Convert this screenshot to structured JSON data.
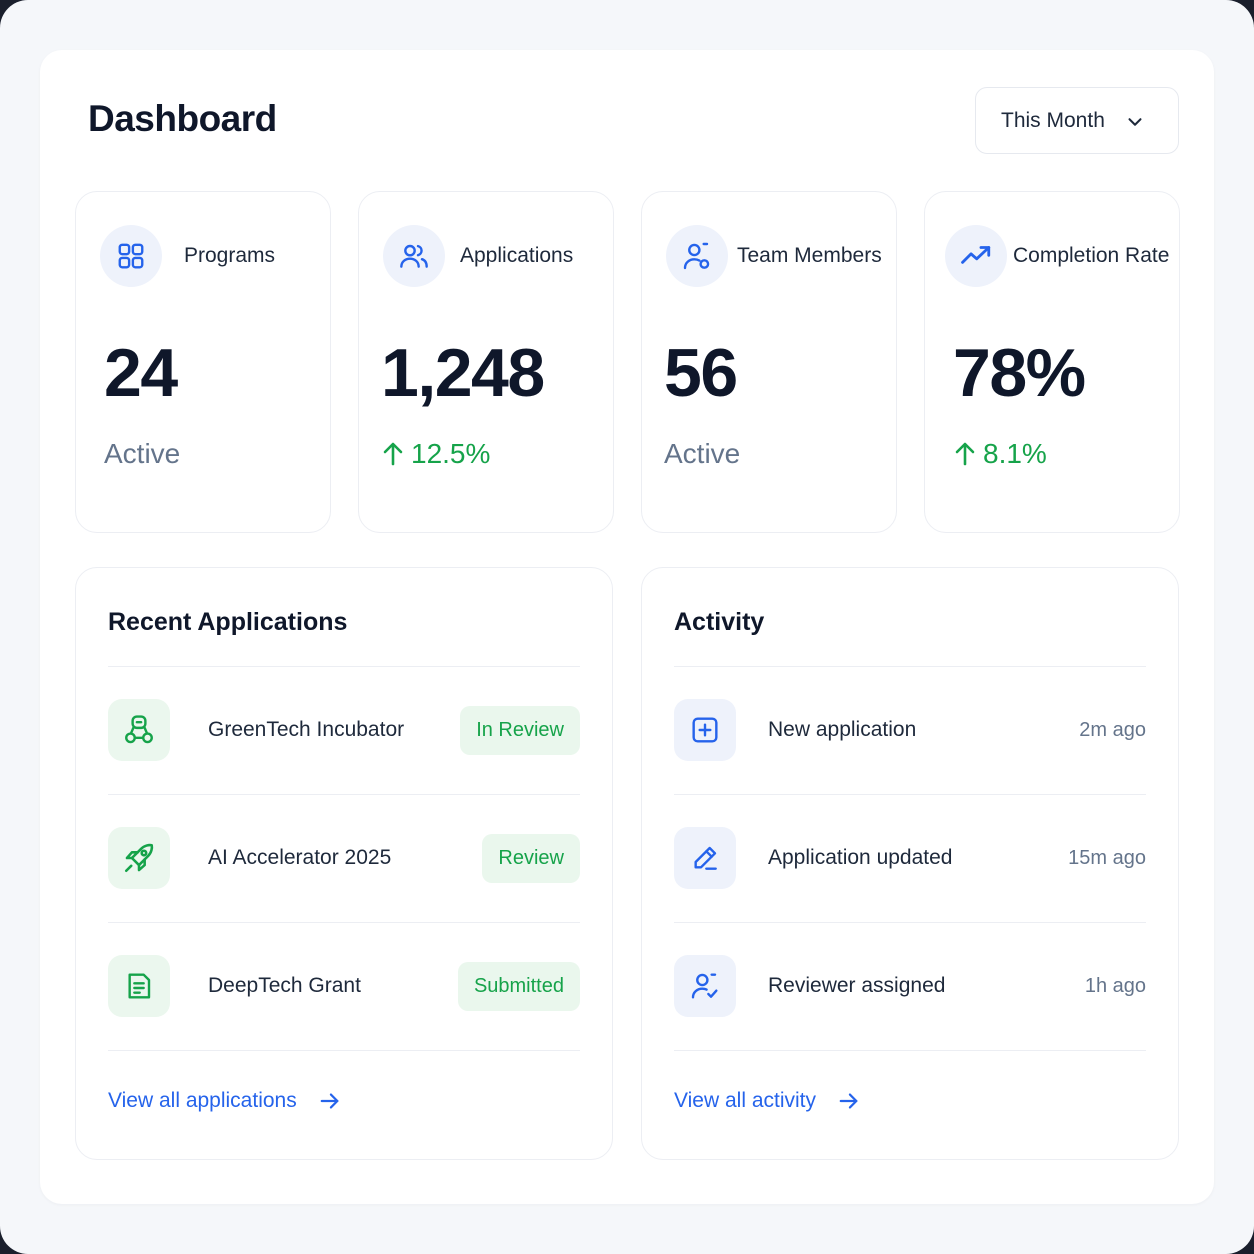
{
  "header": {
    "title": "Dashboard",
    "period": "This Month"
  },
  "stats": [
    {
      "label": "Programs",
      "value": "24",
      "sub": "Active",
      "icon": "grid-icon"
    },
    {
      "label": "Applications",
      "value": "1,248",
      "trend": "12.5%",
      "icon": "users-icon"
    },
    {
      "label": "Team Members",
      "value": "56",
      "sub": "Active",
      "icon": "user-add-icon"
    },
    {
      "label": "Completion Rate",
      "value": "78%",
      "trend": "8.1%",
      "icon": "trend-icon"
    }
  ],
  "recent": {
    "title": "Recent Applications",
    "items": [
      {
        "name": "GreenTech Incubator",
        "status": "In Review",
        "icon": "robot-icon"
      },
      {
        "name": "AI Accelerator 2025",
        "status": "Review",
        "icon": "rocket-icon"
      },
      {
        "name": "DeepTech Grant",
        "status": "Submitted",
        "icon": "document-icon"
      }
    ],
    "link": "View all applications"
  },
  "activity": {
    "title": "Activity",
    "items": [
      {
        "name": "New application",
        "time": "2m ago",
        "icon": "plus-square-icon"
      },
      {
        "name": "Application updated",
        "time": "15m ago",
        "icon": "pencil-icon"
      },
      {
        "name": "Reviewer assigned",
        "time": "1h ago",
        "icon": "user-check-icon"
      }
    ],
    "link": "View all activity"
  },
  "colors": {
    "accent": "#2563eb",
    "success": "#16a34a",
    "text": "#0f172a",
    "muted": "#64748b"
  }
}
